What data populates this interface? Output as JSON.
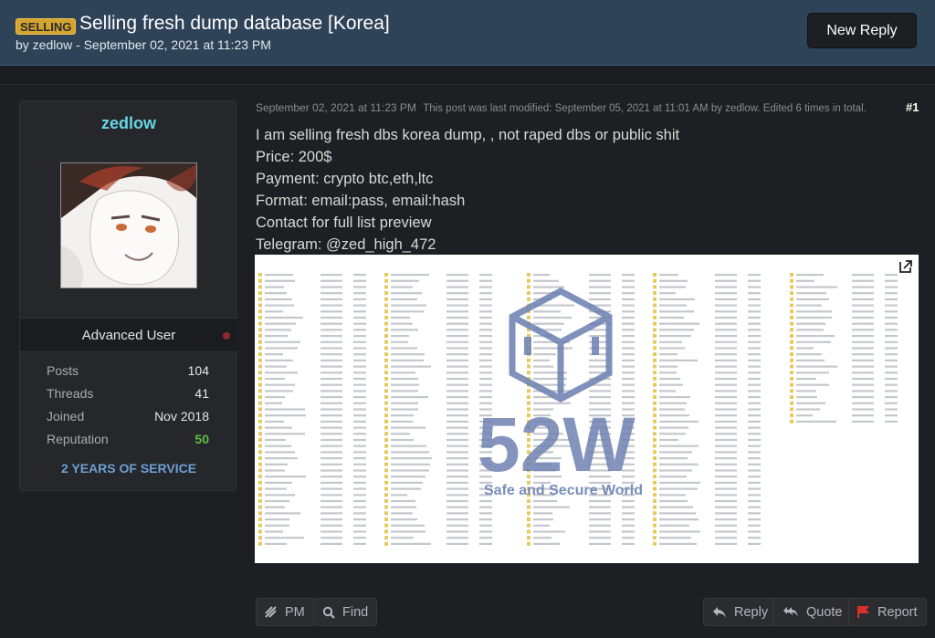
{
  "thread": {
    "prefix": "SELLING",
    "title": "Selling fresh dump database [Korea]",
    "byline": "by zedlow - September 02, 2021 at 11:23 PM",
    "new_reply_label": "New Reply"
  },
  "user": {
    "username": "zedlow",
    "rank": "Advanced User",
    "stats": [
      {
        "label": "Posts",
        "value": "104"
      },
      {
        "label": "Threads",
        "value": "41"
      },
      {
        "label": "Joined",
        "value": "Nov 2018"
      },
      {
        "label": "Reputation",
        "value": "50"
      }
    ],
    "service_badge": "2 YEARS OF SERVICE"
  },
  "post": {
    "date": "September 02, 2021 at 11:23 PM",
    "edited_note": "This post was last modified: September 05, 2021 at 11:01 AM by zedlow. Edited 6 times in total.",
    "number": "#1",
    "lines": [
      "I am selling fresh dbs korea dump, , not raped dbs or public shit",
      "Price: 200$",
      "Payment: crypto btc,eth,ltc",
      "Format: email:pass, email:hash",
      "Contact for full list preview",
      "Telegram: @zed_high_472"
    ],
    "watermark_logo": "52W",
    "watermark_tagline": "Safe and Secure World"
  },
  "actions": {
    "pm": "PM",
    "find": "Find",
    "reply": "Reply",
    "quote": "Quote",
    "report": "Report"
  },
  "icons": {
    "pm": "pm-icon",
    "find": "search-icon",
    "reply": "reply-icon",
    "quote": "quote-icon",
    "report": "flag-icon",
    "open": "external-link-icon"
  },
  "colors": {
    "header_bg": "#2f4358",
    "prefix_badge": "#d4a431",
    "username": "#66d6e6",
    "reputation": "#5fbe4a",
    "service_badge": "#6e9fd4",
    "report_flag": "#d9302c"
  }
}
